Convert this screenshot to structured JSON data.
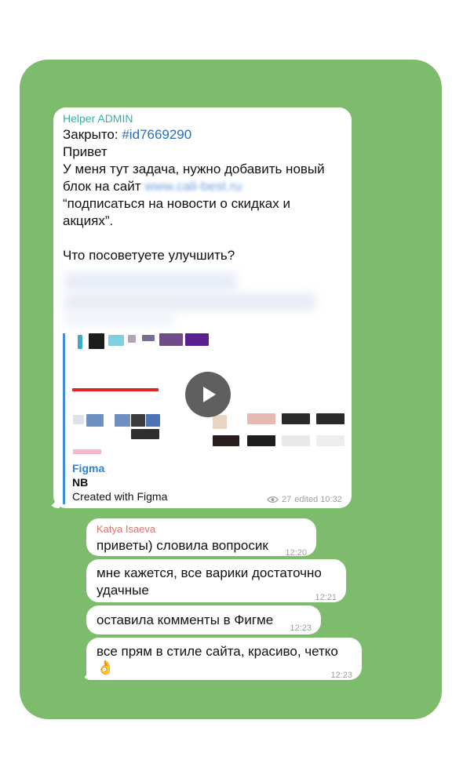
{
  "admin_message": {
    "sender": "Helper ADMIN",
    "closed_label": "Закрыто: ",
    "ticket_id": "#id7669290",
    "line_greeting": "Привет",
    "line_task_1": "У меня тут задача, нужно добавить новый",
    "line_task_2": "блок на сайт ",
    "site_link": "www.cali-best.ru",
    "line_quote_1": "“подписаться на новости о скидках и",
    "line_quote_2": "акциях”.",
    "line_question": "Что посоветуете улучшить?",
    "link_preview": {
      "site_name": "Figma",
      "title": "NB",
      "description": "Created with Figma"
    },
    "views": "27",
    "meta": "edited 10:32"
  },
  "replies": {
    "sender": "Katya Isaeva",
    "items": [
      {
        "text": "приветы) словила вопросик",
        "time": "12:20"
      },
      {
        "text_1": "мне кажется, все варики достаточно",
        "text_2": "удачные",
        "time": "12:21"
      },
      {
        "text": "оставила комменты в Фигме",
        "time": "12:23"
      },
      {
        "text_1": "все прям в стиле сайта, красиво, четко",
        "emoji": "👌",
        "time": "12:23"
      }
    ]
  },
  "colors": {
    "chat_background": "#7dbc6d",
    "admin_name": "#2bb3a3",
    "reply_name": "#e0726b",
    "link": "#2a6fb3",
    "preview_accent": "#3d8fd6"
  },
  "icons": [
    "eye-icon",
    "play-icon",
    "ok-hand-emoji"
  ]
}
